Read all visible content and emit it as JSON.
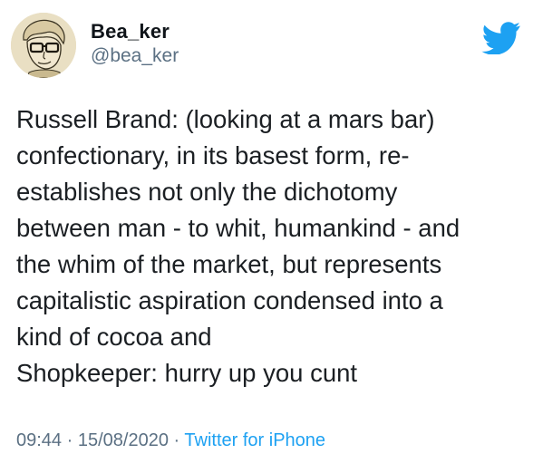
{
  "user": {
    "display_name": "Bea_ker",
    "handle": "@bea_ker",
    "avatar_icon": "cartoon-portrait-avatar"
  },
  "brand": {
    "icon": "twitter-bird-icon",
    "color": "#1da1f2"
  },
  "tweet": {
    "lines": [
      "Russell Brand: (looking at a mars bar)",
      "confectionary, in its basest form, re-",
      "establishes not only the dichotomy",
      "between man - to whit, humankind - and",
      "the whim of the market, but represents",
      "capitalistic aspiration condensed into a",
      "kind of cocoa and",
      "Shopkeeper: hurry up you cunt"
    ]
  },
  "meta": {
    "time": "09:44",
    "separator": "·",
    "date": "15/08/2020",
    "source": "Twitter for iPhone"
  }
}
